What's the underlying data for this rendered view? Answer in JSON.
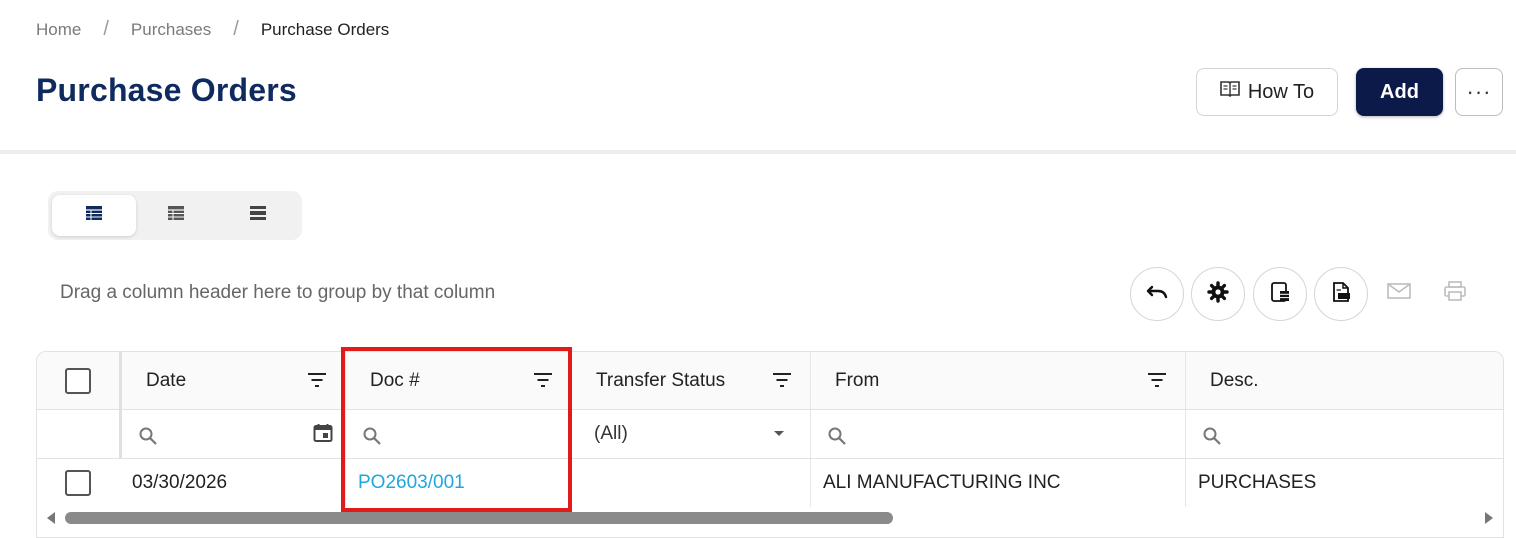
{
  "breadcrumb": {
    "home": "Home",
    "purchases": "Purchases",
    "current": "Purchase Orders",
    "separator": "/"
  },
  "page": {
    "title": "Purchase Orders"
  },
  "actions": {
    "howto_label": "How To",
    "add_label": "Add",
    "more_label": "···"
  },
  "grid": {
    "group_hint": "Drag a column header here to group by that column",
    "columns": {
      "date": "Date",
      "doc": "Doc #",
      "transfer_status": "Transfer Status",
      "from": "From",
      "desc": "Desc."
    },
    "filters": {
      "transfer_status_value": "(All)"
    },
    "rows": [
      {
        "date": "03/30/2026",
        "doc": "PO2603/001",
        "transfer_status": "",
        "from": "ALI MANUFACTURING INC",
        "desc": "PURCHASES"
      }
    ]
  },
  "colors": {
    "title": "#0e2a5e",
    "add_button": "#0c1a4a",
    "link": "#1ea7df",
    "highlight": "#e11a1a"
  },
  "icons": {
    "howto": "book-open-icon",
    "views": [
      "table-view-icon",
      "list-view-icon",
      "compact-view-icon"
    ],
    "toolbar": [
      "undo-icon",
      "gear-icon",
      "export-excel-icon",
      "export-pdf-icon",
      "email-icon",
      "print-icon"
    ]
  }
}
